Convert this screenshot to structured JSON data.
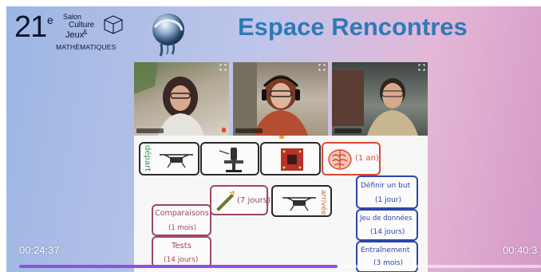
{
  "logo": {
    "number": "21",
    "superscript": "e",
    "line1": "Salon",
    "line2": "Culture",
    "line3": "Jeux",
    "ampersand": "&",
    "line4": "MATHÉMATIQUES"
  },
  "header": {
    "title": "Espace Rencontres"
  },
  "whiteboard": {
    "depart": "départ",
    "brain_label": "(1 an)",
    "champagne_label": "(7 jours)",
    "arrivee": "arrivée",
    "comparaisons": "Comparaisons",
    "comparaisons_duration": "(1 mois)",
    "tests": "Tests",
    "tests_duration": "(14 jours)",
    "definir": "Définir un but",
    "definir_duration": "(1 jour)",
    "jeu": "Jeu de données",
    "jeu_duration": "(14 jours)",
    "entrainement": "Entraînement",
    "entrainement_duration": "(3 mois)"
  },
  "player": {
    "current_time": "00:24:37",
    "total_time": "00:40:3",
    "progress_fraction": 0.61
  },
  "colors": {
    "title": "#2f79b8",
    "progress": "#8a53d8",
    "box_red": "#d9492f",
    "box_pink": "#9d4762",
    "box_blue": "#2f46a8",
    "handwriting_green": "#2e9a52"
  }
}
